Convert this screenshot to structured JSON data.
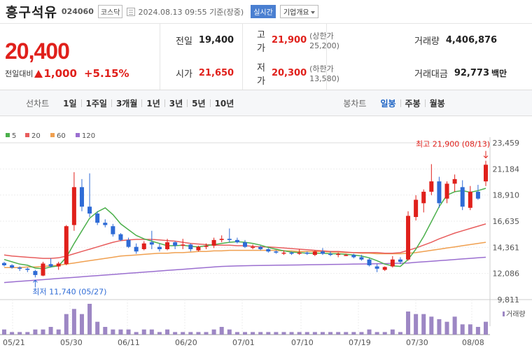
{
  "header": {
    "name": "흥구석유",
    "code": "024060",
    "market": "코스닥",
    "timestamp": "2024.08.13 09:55 기준(장중)",
    "realtime_btn": "실시간",
    "company_btn": "기업개요"
  },
  "quote": {
    "price": "20,400",
    "change_label": "전일대비",
    "change_amount": "1,000",
    "change_pct": "+5.15%",
    "prev_label": "전일",
    "prev": "19,400",
    "high_label": "고가",
    "high": "21,900",
    "upper_limit": "(상한가 25,200)",
    "volume_label": "거래량",
    "volume": "4,406,876",
    "open_label": "시가",
    "open": "21,650",
    "low_label": "저가",
    "low": "20,300",
    "lower_limit": "(하한가 13,580)",
    "amount_label": "거래대금",
    "amount": "92,773",
    "amount_unit": "백만"
  },
  "toolbar": {
    "line_label": "선차트",
    "periods": [
      "1일",
      "1주일",
      "3개월",
      "1년",
      "3년",
      "5년",
      "10년"
    ],
    "candle_label": "봉차트",
    "candles": [
      "일봉",
      "주봉",
      "월봉"
    ],
    "active_candle": "일봉"
  },
  "colors": {
    "up": "#e0201b",
    "down": "#2e6bd6",
    "ma5": "#4cb04c",
    "ma20": "#e85d5d",
    "ma60": "#f0a050",
    "ma120": "#9b6fd0",
    "volume": "#9d87c4"
  },
  "chart_data": {
    "type": "candlestick",
    "legend": [
      "5",
      "20",
      "60",
      "120"
    ],
    "y_ticks": [
      "23,459",
      "21,184",
      "18,910",
      "16,635",
      "14,361",
      "12,086",
      "9,811"
    ],
    "ylim": [
      9811,
      23459
    ],
    "x_ticks": [
      "05/21",
      "05/30",
      "06/11",
      "06/20",
      "07/01",
      "07/10",
      "07/19",
      "07/30",
      "08/08"
    ],
    "annotations": {
      "max": "최고 21,900 (08/13)",
      "min": "최저 11,740 (05/27)"
    },
    "volume_label": "거래량",
    "candles": [
      [
        13000,
        13100,
        12700,
        12800
      ],
      [
        12800,
        12900,
        12500,
        12600
      ],
      [
        12600,
        12700,
        12300,
        12500
      ],
      [
        12500,
        12600,
        12200,
        12400
      ],
      [
        12300,
        12400,
        11740,
        11950
      ],
      [
        11900,
        13100,
        11850,
        12950
      ],
      [
        12900,
        13400,
        12600,
        12700
      ],
      [
        12700,
        13100,
        12400,
        12950
      ],
      [
        12900,
        16300,
        12800,
        16200
      ],
      [
        16300,
        20900,
        15800,
        19600
      ],
      [
        19600,
        20300,
        17500,
        17900
      ],
      [
        17900,
        20800,
        17000,
        17300
      ],
      [
        17300,
        17500,
        16300,
        16500
      ],
      [
        16500,
        16800,
        16100,
        16300
      ],
      [
        16200,
        16400,
        15300,
        15500
      ],
      [
        15500,
        15600,
        14900,
        15000
      ],
      [
        15000,
        15200,
        14300,
        14400
      ],
      [
        14400,
        14700,
        13800,
        14000
      ],
      [
        14200,
        14900,
        14100,
        14700
      ],
      [
        14800,
        15800,
        14200,
        14600
      ],
      [
        14400,
        14700,
        14000,
        14200
      ],
      [
        14200,
        15100,
        14100,
        14800
      ],
      [
        14800,
        14900,
        14200,
        14500
      ],
      [
        14500,
        15100,
        14200,
        14600
      ],
      [
        14600,
        14700,
        14000,
        14200
      ],
      [
        14100,
        14500,
        14000,
        14400
      ],
      [
        14400,
        14700,
        14200,
        14500
      ],
      [
        14500,
        15200,
        14300,
        15000
      ],
      [
        15000,
        15400,
        14800,
        15100
      ],
      [
        15100,
        16000,
        14800,
        15000
      ],
      [
        15000,
        15200,
        14700,
        14800
      ],
      [
        14800,
        15000,
        14300,
        14400
      ],
      [
        14400,
        14600,
        14200,
        14400
      ],
      [
        14400,
        14500,
        14100,
        14200
      ],
      [
        14200,
        14300,
        13900,
        14000
      ],
      [
        14000,
        14100,
        13800,
        13900
      ],
      [
        13900,
        14100,
        13700,
        13900
      ],
      [
        13900,
        14000,
        13700,
        13800
      ],
      [
        13800,
        14200,
        13700,
        13900
      ],
      [
        13900,
        14000,
        13700,
        13800
      ],
      [
        13700,
        14100,
        13600,
        14000
      ],
      [
        14000,
        14300,
        13700,
        13800
      ],
      [
        13800,
        14000,
        13600,
        13700
      ],
      [
        13700,
        13900,
        13500,
        13800
      ],
      [
        13700,
        13800,
        13600,
        13700
      ],
      [
        13700,
        13800,
        13400,
        13500
      ],
      [
        13500,
        13700,
        13200,
        13300
      ],
      [
        13300,
        13400,
        12700,
        12800
      ],
      [
        12700,
        12900,
        12200,
        12500
      ],
      [
        12400,
        12700,
        12300,
        12650
      ],
      [
        12700,
        13600,
        12600,
        13300
      ],
      [
        13300,
        13500,
        12900,
        13100
      ],
      [
        13300,
        17500,
        13200,
        17100
      ],
      [
        17000,
        18900,
        16700,
        18500
      ],
      [
        18200,
        19400,
        17400,
        19200
      ],
      [
        19200,
        21600,
        18900,
        20100
      ],
      [
        20100,
        20500,
        17800,
        18200
      ],
      [
        18600,
        20100,
        18200,
        19900
      ],
      [
        19900,
        20700,
        19200,
        20300
      ],
      [
        19600,
        20200,
        17600,
        17900
      ],
      [
        17800,
        19700,
        17600,
        19200
      ],
      [
        19200,
        19800,
        18500,
        18600
      ],
      [
        20100,
        21900,
        19700,
        21550
      ]
    ],
    "ma5": [
      13300,
      13100,
      12900,
      12800,
      12550,
      12500,
      12650,
      12750,
      13500,
      14700,
      15800,
      16900,
      17450,
      17800,
      17200,
      16400,
      15900,
      15400,
      15100,
      14900,
      14700,
      14500,
      14500,
      14550,
      14450,
      14400,
      14500,
      14600,
      14700,
      14800,
      14850,
      14800,
      14700,
      14550,
      14350,
      14200,
      14050,
      13950,
      13900,
      13850,
      13850,
      13850,
      13800,
      13800,
      13750,
      13700,
      13600,
      13450,
      13200,
      12900,
      12750,
      12700,
      13300,
      14200,
      15300,
      16600,
      17900,
      18900,
      19200,
      19300,
      19150,
      19300,
      19500
    ],
    "ma20": [
      13700,
      13600,
      13550,
      13500,
      13450,
      13400,
      13400,
      13450,
      13600,
      13800,
      14000,
      14200,
      14400,
      14600,
      14800,
      14950,
      15000,
      15050,
      15050,
      15050,
      15000,
      14950,
      14900,
      14800,
      14700,
      14650,
      14600,
      14550,
      14550,
      14550,
      14500,
      14500,
      14450,
      14400,
      14400,
      14350,
      14300,
      14250,
      14200,
      14150,
      14100,
      14050,
      14000,
      14000,
      13950,
      13900,
      13900,
      13900,
      13900,
      13850,
      13850,
      13900,
      14100,
      14300,
      14550,
      14800,
      15100,
      15350,
      15600,
      15800,
      16000,
      16200,
      16400
    ],
    "ma60": [
      12600,
      12600,
      12600,
      12650,
      12650,
      12700,
      12750,
      12800,
      12900,
      13000,
      13100,
      13200,
      13300,
      13400,
      13500,
      13600,
      13650,
      13700,
      13750,
      13800,
      13850,
      13850,
      13900,
      13900,
      13950,
      14000,
      14000,
      14050,
      14050,
      14100,
      14100,
      14100,
      14100,
      14100,
      14100,
      14100,
      14050,
      14050,
      14000,
      14000,
      14000,
      14000,
      13950,
      13950,
      13900,
      13900,
      13850,
      13850,
      13800,
      13800,
      13800,
      13800,
      13850,
      13900,
      14000,
      14100,
      14200,
      14300,
      14400,
      14500,
      14600,
      14700,
      14800
    ],
    "ma120": [
      11300,
      11350,
      11400,
      11450,
      11500,
      11550,
      11600,
      11650,
      11700,
      11750,
      11800,
      11850,
      11900,
      11950,
      12000,
      12050,
      12100,
      12150,
      12200,
      12250,
      12300,
      12350,
      12400,
      12450,
      12500,
      12550,
      12600,
      12650,
      12700,
      12720,
      12740,
      12760,
      12770,
      12780,
      12790,
      12800,
      12810,
      12820,
      12830,
      12840,
      12850,
      12860,
      12870,
      12880,
      12890,
      12900,
      12910,
      12920,
      12930,
      12940,
      12960,
      12980,
      13000,
      13050,
      13100,
      13150,
      13200,
      13250,
      13300,
      13350,
      13400,
      13450,
      13500
    ],
    "volumes": [
      2,
      1,
      1,
      1,
      2,
      2,
      3,
      2,
      8,
      10,
      8,
      12,
      5,
      3,
      2,
      2,
      2,
      1,
      2,
      2,
      1,
      2,
      1,
      1,
      1,
      1,
      1,
      2,
      3,
      2,
      1,
      1,
      1,
      1,
      1,
      1,
      1,
      1,
      1,
      1,
      1,
      1,
      1,
      1,
      1,
      1,
      1,
      2,
      1,
      1,
      2,
      1,
      9,
      8,
      8,
      7,
      6,
      5,
      7,
      4,
      4,
      3,
      5
    ]
  }
}
